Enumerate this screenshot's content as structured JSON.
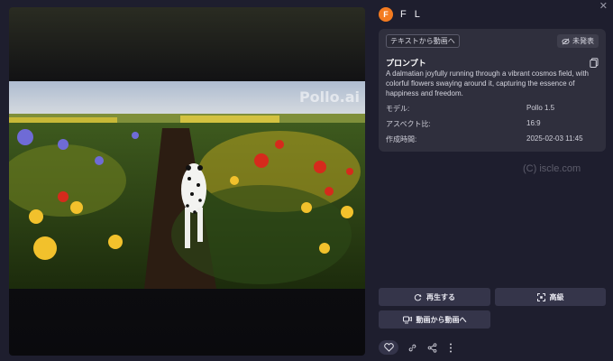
{
  "video": {
    "watermark": "Pollo.ai"
  },
  "user": {
    "avatar_letter": "F",
    "name": "F L"
  },
  "card": {
    "mode_tag": "テキストから動画へ",
    "visibility_label": "未発表",
    "prompt_title": "プロンプト",
    "prompt_text": "A dalmatian joyfully running through a vibrant cosmos field, with colorful flowers swaying around it, capturing the essence of happiness and freedom.",
    "meta": [
      {
        "key": "モデル:",
        "value": "Pollo 1.5"
      },
      {
        "key": "アスペクト比:",
        "value": "16:9"
      },
      {
        "key": "作成時間:",
        "value": "2025-02-03   11:45"
      }
    ]
  },
  "copyright": "(C) iscle.com",
  "actions": {
    "regenerate_label": "再生する",
    "upscale_label": "高級",
    "video_to_video_label": "動画から動画へ"
  },
  "colors": {
    "background": "#1e1e2e",
    "card": "#2f2f3d",
    "button": "#35354a",
    "avatar": "#f47b20"
  }
}
